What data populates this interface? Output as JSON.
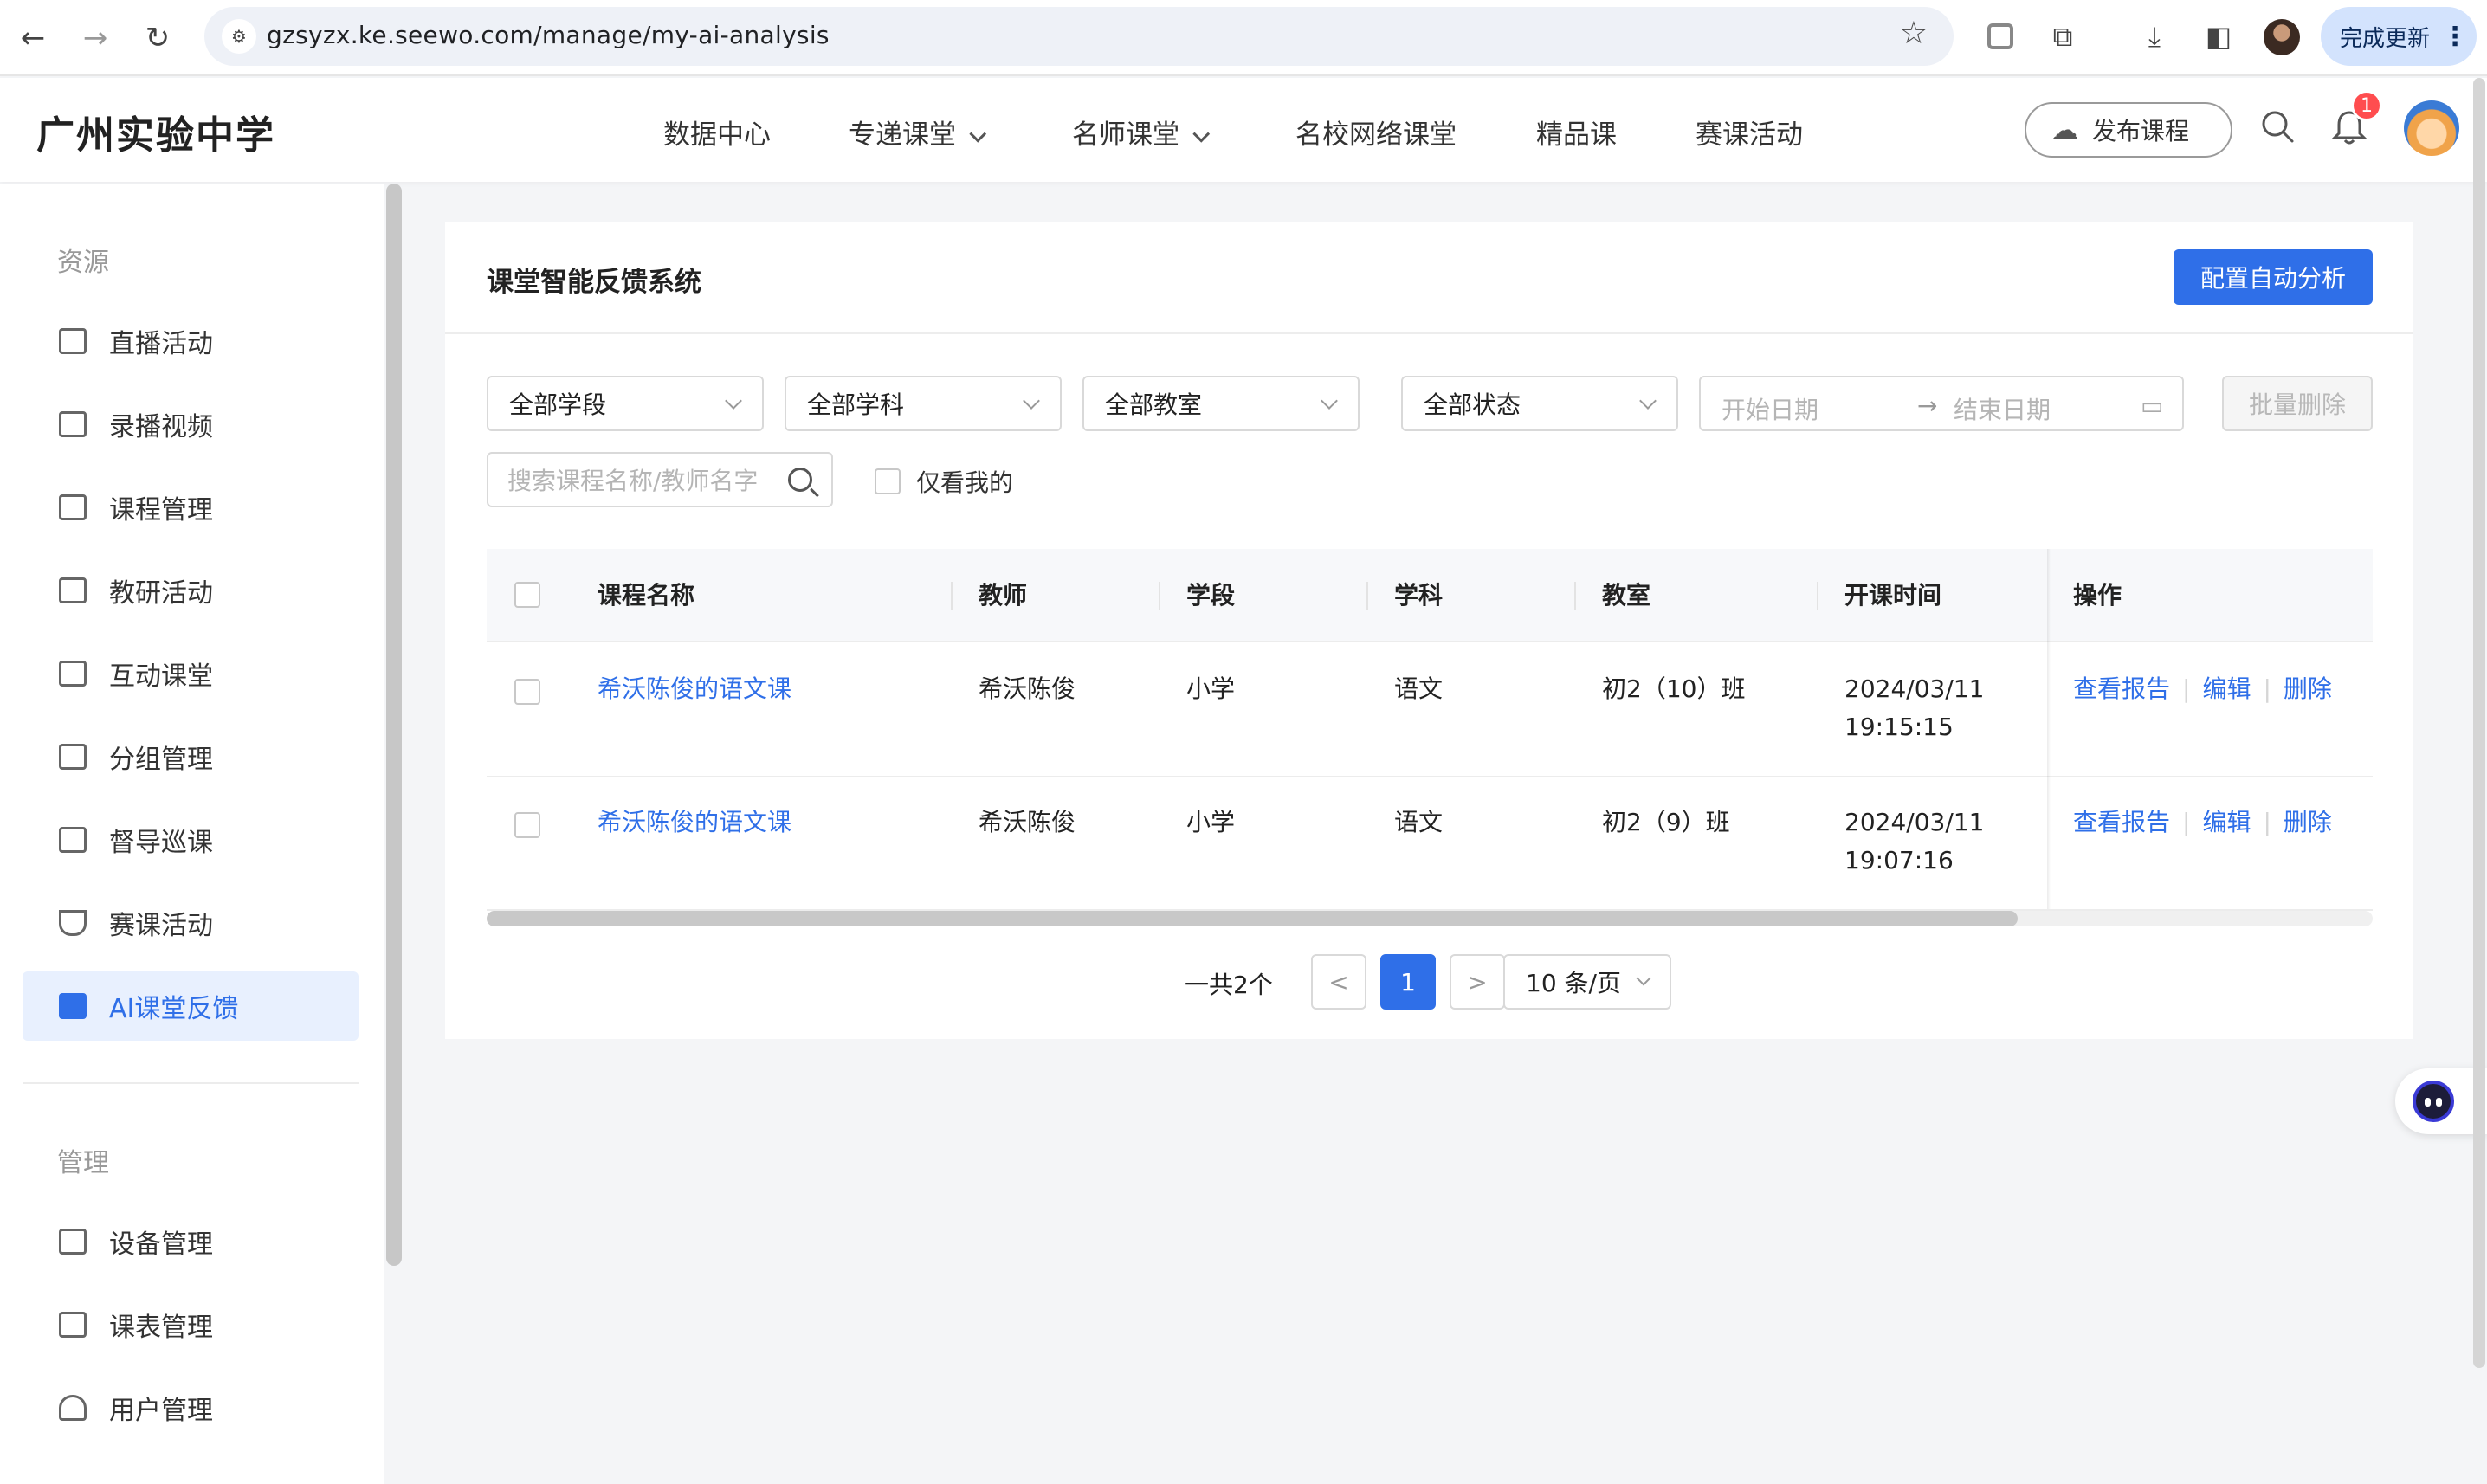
{
  "browser": {
    "url": "gzsyzx.ke.seewo.com/manage/my-ai-analysis",
    "update_label": "完成更新"
  },
  "header": {
    "school_name": "广州实验中学",
    "nav": [
      {
        "label": "数据中心",
        "dropdown": false
      },
      {
        "label": "专递课堂",
        "dropdown": true
      },
      {
        "label": "名师课堂",
        "dropdown": true
      },
      {
        "label": "名校网络课堂",
        "dropdown": false
      },
      {
        "label": "精品课",
        "dropdown": false
      },
      {
        "label": "赛课活动",
        "dropdown": false
      }
    ],
    "publish_label": "发布课程",
    "notification_count": "1"
  },
  "sidebar": {
    "section_resources": "资源",
    "section_manage": "管理",
    "items": [
      {
        "label": "直播活动",
        "icon": "live-tv-icon"
      },
      {
        "label": "录播视频",
        "icon": "video-play-icon"
      },
      {
        "label": "课程管理",
        "icon": "book-icon"
      },
      {
        "label": "教研活动",
        "icon": "bookmark-icon"
      },
      {
        "label": "互动课堂",
        "icon": "chat-icon"
      },
      {
        "label": "分组管理",
        "icon": "folder-icon"
      },
      {
        "label": "督导巡课",
        "icon": "monitor-play-icon"
      },
      {
        "label": "赛课活动",
        "icon": "trophy-icon"
      },
      {
        "label": "AI课堂反馈",
        "icon": "ai-feedback-icon",
        "active": true
      }
    ],
    "manage_items": [
      {
        "label": "设备管理",
        "icon": "device-icon"
      },
      {
        "label": "课表管理",
        "icon": "calendar-icon"
      },
      {
        "label": "用户管理",
        "icon": "user-icon"
      }
    ]
  },
  "main": {
    "title": "课堂智能反馈系统",
    "config_button": "配置自动分析",
    "filters": {
      "stage": "全部学段",
      "subject": "全部学科",
      "classroom": "全部教室",
      "status": "全部状态",
      "start_date_placeholder": "开始日期",
      "end_date_placeholder": "结束日期",
      "batch_delete": "批量删除",
      "search_placeholder": "搜索课程名称/教师名字",
      "only_mine": "仅看我的"
    },
    "table": {
      "columns": [
        "课程名称",
        "教师",
        "学段",
        "学科",
        "教室",
        "开课时间",
        "操作"
      ],
      "rows": [
        {
          "course": "希沃陈俊的语文课",
          "teacher": "希沃陈俊",
          "stage": "小学",
          "subject": "语文",
          "classroom": "初2（10）班",
          "date": "2024/03/11",
          "time": "19:15:15"
        },
        {
          "course": "希沃陈俊的语文课",
          "teacher": "希沃陈俊",
          "stage": "小学",
          "subject": "语文",
          "classroom": "初2（9）班",
          "date": "2024/03/11",
          "time": "19:07:16"
        }
      ],
      "actions": {
        "view": "查看报告",
        "edit": "编辑",
        "delete": "删除"
      }
    },
    "pagination": {
      "total": "一共2个",
      "current_page": "1",
      "page_size": "10 条/页"
    }
  },
  "colors": {
    "accent": "#2f6fe8",
    "badge": "#ff4d4f"
  }
}
